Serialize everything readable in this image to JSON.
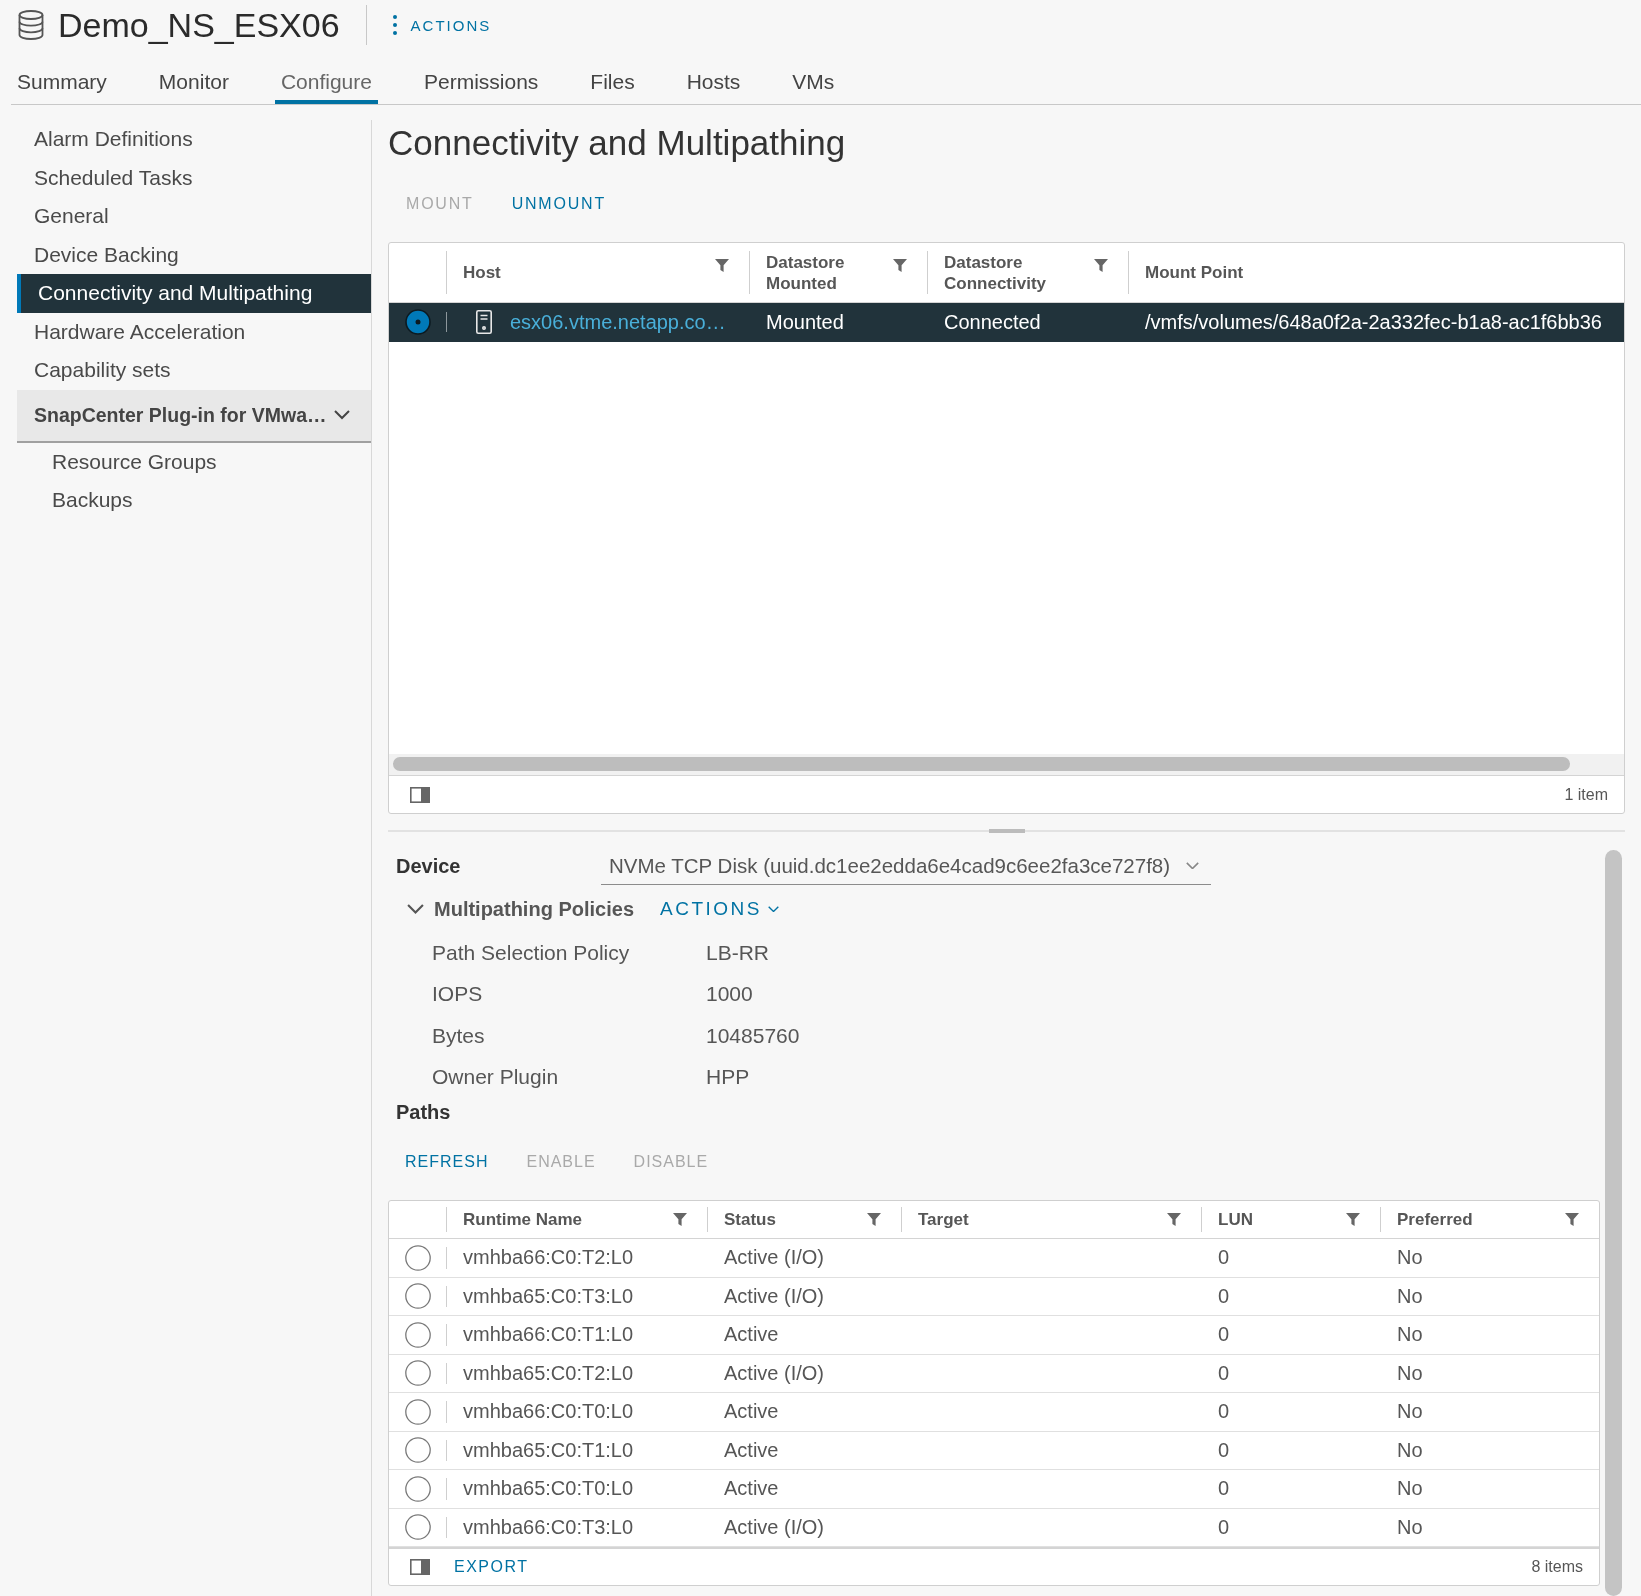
{
  "header": {
    "title": "Demo_NS_ESX06",
    "actions": "ACTIONS"
  },
  "tabs": [
    {
      "label": "Summary",
      "selected": false
    },
    {
      "label": "Monitor",
      "selected": false
    },
    {
      "label": "Configure",
      "selected": true
    },
    {
      "label": "Permissions",
      "selected": false
    },
    {
      "label": "Files",
      "selected": false
    },
    {
      "label": "Hosts",
      "selected": false
    },
    {
      "label": "VMs",
      "selected": false
    }
  ],
  "sidebar": {
    "items": [
      {
        "label": "Alarm Definitions",
        "selected": false
      },
      {
        "label": "Scheduled Tasks",
        "selected": false
      },
      {
        "label": "General",
        "selected": false
      },
      {
        "label": "Device Backing",
        "selected": false
      },
      {
        "label": "Connectivity and Multipathing",
        "selected": true
      },
      {
        "label": "Hardware Acceleration",
        "selected": false
      },
      {
        "label": "Capability sets",
        "selected": false
      }
    ],
    "group": {
      "label": "SnapCenter Plug-in for VMwa…",
      "expanded": true,
      "children": [
        {
          "label": "Resource Groups",
          "selected": false
        },
        {
          "label": "Backups",
          "selected": false
        }
      ]
    }
  },
  "page": {
    "title": "Connectivity and Multipathing",
    "toolbar": [
      {
        "label": "MOUNT",
        "disabled": true
      },
      {
        "label": "UNMOUNT",
        "disabled": false
      }
    ]
  },
  "hosts_table": {
    "columns": [
      {
        "label": "Host",
        "filter": true
      },
      {
        "label": "Datastore Mounted",
        "filter": true
      },
      {
        "label": "Datastore Connectivity",
        "filter": true
      },
      {
        "label": "Mount Point",
        "filter": false
      }
    ],
    "rows": [
      {
        "selected": true,
        "host": "esx06.vtme.netapp.co…",
        "datastore_mounted": "Mounted",
        "datastore_connectivity": "Connected",
        "mount_point": "/vmfs/volumes/648a0f2a-2a332fec-b1a8-ac1f6bb36"
      }
    ],
    "footer": "1 item"
  },
  "device": {
    "label": "Device",
    "value": "NVMe TCP Disk (uuid.dc1ee2edda6e4cad9c6ee2fa3ce727f8)"
  },
  "policies": {
    "title": "Multipathing Policies",
    "expanded": true,
    "actions": "ACTIONS",
    "fields": [
      {
        "label": "Path Selection Policy",
        "value": "LB-RR"
      },
      {
        "label": "IOPS",
        "value": "1000"
      },
      {
        "label": "Bytes",
        "value": "10485760"
      },
      {
        "label": "Owner Plugin",
        "value": "HPP"
      }
    ]
  },
  "paths": {
    "title": "Paths",
    "toolbar": [
      {
        "label": "REFRESH",
        "disabled": false
      },
      {
        "label": "ENABLE",
        "disabled": true
      },
      {
        "label": "DISABLE",
        "disabled": true
      }
    ],
    "columns": [
      {
        "label": "Runtime Name",
        "filter": true
      },
      {
        "label": "Status",
        "filter": true
      },
      {
        "label": "Target",
        "filter": true
      },
      {
        "label": "LUN",
        "filter": true
      },
      {
        "label": "Preferred",
        "filter": true
      }
    ],
    "rows": [
      {
        "selected": false,
        "runtime_name": "vmhba66:C0:T2:L0",
        "status": "Active (I/O)",
        "lun": "0",
        "preferred": "No"
      },
      {
        "selected": false,
        "runtime_name": "vmhba65:C0:T3:L0",
        "status": "Active (I/O)",
        "lun": "0",
        "preferred": "No"
      },
      {
        "selected": false,
        "runtime_name": "vmhba66:C0:T1:L0",
        "status": "Active",
        "lun": "0",
        "preferred": "No"
      },
      {
        "selected": false,
        "runtime_name": "vmhba65:C0:T2:L0",
        "status": "Active (I/O)",
        "lun": "0",
        "preferred": "No"
      },
      {
        "selected": false,
        "runtime_name": "vmhba66:C0:T0:L0",
        "status": "Active",
        "lun": "0",
        "preferred": "No"
      },
      {
        "selected": false,
        "runtime_name": "vmhba65:C0:T1:L0",
        "status": "Active",
        "lun": "0",
        "preferred": "No"
      },
      {
        "selected": false,
        "runtime_name": "vmhba65:C0:T0:L0",
        "status": "Active",
        "lun": "0",
        "preferred": "No"
      },
      {
        "selected": false,
        "runtime_name": "vmhba66:C0:T3:L0",
        "status": "Active (I/O)",
        "lun": "0",
        "preferred": "No"
      }
    ],
    "export": "EXPORT",
    "footer": "8 items"
  }
}
